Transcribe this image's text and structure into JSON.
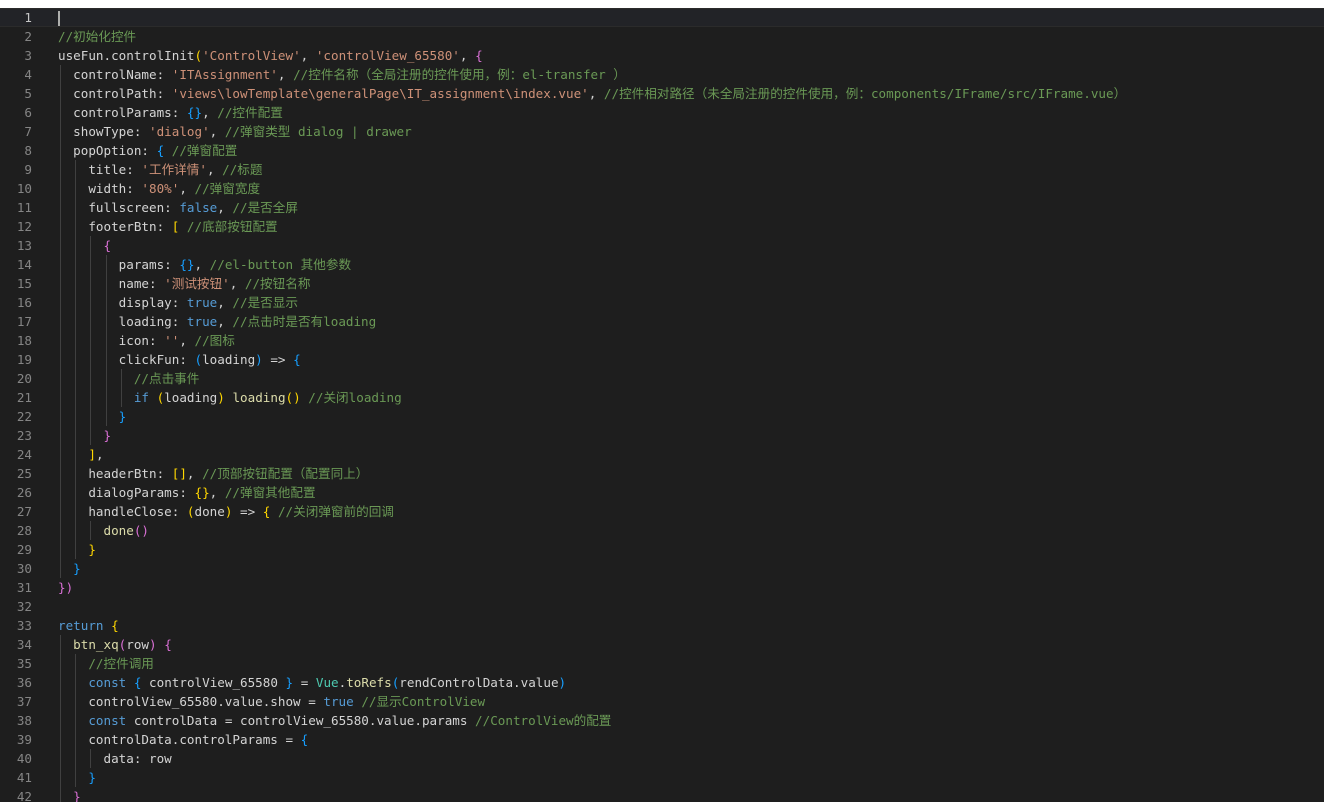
{
  "editor": {
    "lines": [
      [],
      [
        [
          "//初始化控件",
          "comment"
        ]
      ],
      [
        [
          "useFun.controlInit",
          "plain"
        ],
        [
          "(",
          "b1"
        ],
        [
          "'ControlView'",
          "string"
        ],
        [
          ", ",
          "plain"
        ],
        [
          "'controlView_65580'",
          "string"
        ],
        [
          ", ",
          "plain"
        ],
        [
          "{",
          "b2"
        ]
      ],
      [
        [
          "  controlName: ",
          "prop"
        ],
        [
          "'ITAssignment'",
          "string"
        ],
        [
          ", ",
          "plain"
        ],
        [
          "//控件名称（全局注册的控件使用，例：el-transfer ）",
          "comment"
        ]
      ],
      [
        [
          "  controlPath: ",
          "prop"
        ],
        [
          "'views\\lowTemplate\\generalPage\\IT_assignment\\index.vue'",
          "string"
        ],
        [
          ", ",
          "plain"
        ],
        [
          "//控件相对路径（未全局注册的控件使用，例：components/IFrame/src/IFrame.vue）",
          "comment"
        ]
      ],
      [
        [
          "  controlParams: ",
          "prop"
        ],
        [
          "{}",
          "b3"
        ],
        [
          ", ",
          "plain"
        ],
        [
          "//控件配置",
          "comment"
        ]
      ],
      [
        [
          "  showType: ",
          "prop"
        ],
        [
          "'dialog'",
          "string"
        ],
        [
          ", ",
          "plain"
        ],
        [
          "//弹窗类型 dialog | drawer",
          "comment"
        ]
      ],
      [
        [
          "  popOption: ",
          "prop"
        ],
        [
          "{",
          "b3"
        ],
        [
          " ",
          "plain"
        ],
        [
          "//弹窗配置",
          "comment"
        ]
      ],
      [
        [
          "    title: ",
          "prop"
        ],
        [
          "'工作详情'",
          "string"
        ],
        [
          ", ",
          "plain"
        ],
        [
          "//标题",
          "comment"
        ]
      ],
      [
        [
          "    width: ",
          "prop"
        ],
        [
          "'80%'",
          "string"
        ],
        [
          ", ",
          "plain"
        ],
        [
          "//弹窗宽度",
          "comment"
        ]
      ],
      [
        [
          "    fullscreen: ",
          "prop"
        ],
        [
          "false",
          "keyword"
        ],
        [
          ", ",
          "plain"
        ],
        [
          "//是否全屏",
          "comment"
        ]
      ],
      [
        [
          "    footerBtn: ",
          "prop"
        ],
        [
          "[",
          "b1"
        ],
        [
          " ",
          "plain"
        ],
        [
          "//底部按钮配置",
          "comment"
        ]
      ],
      [
        [
          "      ",
          "plain"
        ],
        [
          "{",
          "b2"
        ]
      ],
      [
        [
          "        params: ",
          "prop"
        ],
        [
          "{}",
          "b3"
        ],
        [
          ", ",
          "plain"
        ],
        [
          "//el-button 其他参数",
          "comment"
        ]
      ],
      [
        [
          "        name: ",
          "prop"
        ],
        [
          "'测试按钮'",
          "string"
        ],
        [
          ", ",
          "plain"
        ],
        [
          "//按钮名称",
          "comment"
        ]
      ],
      [
        [
          "        display: ",
          "prop"
        ],
        [
          "true",
          "keyword"
        ],
        [
          ", ",
          "plain"
        ],
        [
          "//是否显示",
          "comment"
        ]
      ],
      [
        [
          "        loading: ",
          "prop"
        ],
        [
          "true",
          "keyword"
        ],
        [
          ", ",
          "plain"
        ],
        [
          "//点击时是否有loading",
          "comment"
        ]
      ],
      [
        [
          "        icon: ",
          "prop"
        ],
        [
          "''",
          "string"
        ],
        [
          ", ",
          "plain"
        ],
        [
          "//图标",
          "comment"
        ]
      ],
      [
        [
          "        clickFun: ",
          "prop"
        ],
        [
          "(",
          "b3"
        ],
        [
          "loading",
          "var"
        ],
        [
          ")",
          "b3"
        ],
        [
          " => ",
          "plain"
        ],
        [
          "{",
          "b3"
        ]
      ],
      [
        [
          "          ",
          "plain"
        ],
        [
          "//点击事件",
          "comment"
        ]
      ],
      [
        [
          "          ",
          "plain"
        ],
        [
          "if",
          "keyword"
        ],
        [
          " ",
          "plain"
        ],
        [
          "(",
          "b1"
        ],
        [
          "loading",
          "var"
        ],
        [
          ")",
          "b1"
        ],
        [
          " ",
          "plain"
        ],
        [
          "loading",
          "func"
        ],
        [
          "()",
          "b1"
        ],
        [
          " ",
          "plain"
        ],
        [
          "//关闭loading",
          "comment"
        ]
      ],
      [
        [
          "        ",
          "plain"
        ],
        [
          "}",
          "b3"
        ]
      ],
      [
        [
          "      ",
          "plain"
        ],
        [
          "}",
          "b2"
        ]
      ],
      [
        [
          "    ",
          "plain"
        ],
        [
          "]",
          "b1"
        ],
        [
          ",",
          "plain"
        ]
      ],
      [
        [
          "    headerBtn: ",
          "prop"
        ],
        [
          "[]",
          "b1"
        ],
        [
          ", ",
          "plain"
        ],
        [
          "//顶部按钮配置（配置同上）",
          "comment"
        ]
      ],
      [
        [
          "    dialogParams: ",
          "prop"
        ],
        [
          "{}",
          "b1"
        ],
        [
          ", ",
          "plain"
        ],
        [
          "//弹窗其他配置",
          "comment"
        ]
      ],
      [
        [
          "    handleClose: ",
          "prop"
        ],
        [
          "(",
          "b1"
        ],
        [
          "done",
          "var"
        ],
        [
          ")",
          "b1"
        ],
        [
          " => ",
          "plain"
        ],
        [
          "{",
          "b1"
        ],
        [
          " ",
          "plain"
        ],
        [
          "//关闭弹窗前的回调",
          "comment"
        ]
      ],
      [
        [
          "      done",
          "func"
        ],
        [
          "()",
          "b2"
        ]
      ],
      [
        [
          "    ",
          "plain"
        ],
        [
          "}",
          "b1"
        ]
      ],
      [
        [
          "  ",
          "plain"
        ],
        [
          "}",
          "b3"
        ]
      ],
      [
        [
          "})",
          "b2"
        ]
      ],
      [],
      [
        [
          "return",
          "keyword"
        ],
        [
          " ",
          "plain"
        ],
        [
          "{",
          "b1"
        ]
      ],
      [
        [
          "  btn_xq",
          "func"
        ],
        [
          "(",
          "b2"
        ],
        [
          "row",
          "var"
        ],
        [
          ")",
          "b2"
        ],
        [
          " ",
          "plain"
        ],
        [
          "{",
          "b2"
        ]
      ],
      [
        [
          "    ",
          "plain"
        ],
        [
          "//控件调用",
          "comment"
        ]
      ],
      [
        [
          "    ",
          "plain"
        ],
        [
          "const",
          "keyword"
        ],
        [
          " ",
          "plain"
        ],
        [
          "{",
          "b3"
        ],
        [
          " controlView_65580 ",
          "var"
        ],
        [
          "}",
          "b3"
        ],
        [
          " = ",
          "plain"
        ],
        [
          "Vue",
          "class"
        ],
        [
          ".",
          "plain"
        ],
        [
          "toRefs",
          "func"
        ],
        [
          "(",
          "b3"
        ],
        [
          "rendControlData.value",
          "var"
        ],
        [
          ")",
          "b3"
        ]
      ],
      [
        [
          "    controlView_65580.value.show = ",
          "var"
        ],
        [
          "true",
          "keyword"
        ],
        [
          " ",
          "plain"
        ],
        [
          "//显示ControlView",
          "comment"
        ]
      ],
      [
        [
          "    ",
          "plain"
        ],
        [
          "const",
          "keyword"
        ],
        [
          " controlData = controlView_65580.value.params ",
          "var"
        ],
        [
          "//ControlView的配置",
          "comment"
        ]
      ],
      [
        [
          "    controlData.controlParams = ",
          "var"
        ],
        [
          "{",
          "b3"
        ]
      ],
      [
        [
          "      data: row",
          "var"
        ]
      ],
      [
        [
          "    ",
          "plain"
        ],
        [
          "}",
          "b3"
        ]
      ],
      [
        [
          "  ",
          "plain"
        ],
        [
          "}",
          "b2"
        ]
      ]
    ],
    "colors": {
      "background": "#1e1e1e",
      "line_number": "#858585",
      "comment": "#6a9955",
      "string": "#ce9178",
      "keyword": "#569cd6",
      "function": "#dcdcaa",
      "bracket_gold": "#ffd700",
      "bracket_orchid": "#da70d6",
      "bracket_blue": "#179fff"
    }
  }
}
